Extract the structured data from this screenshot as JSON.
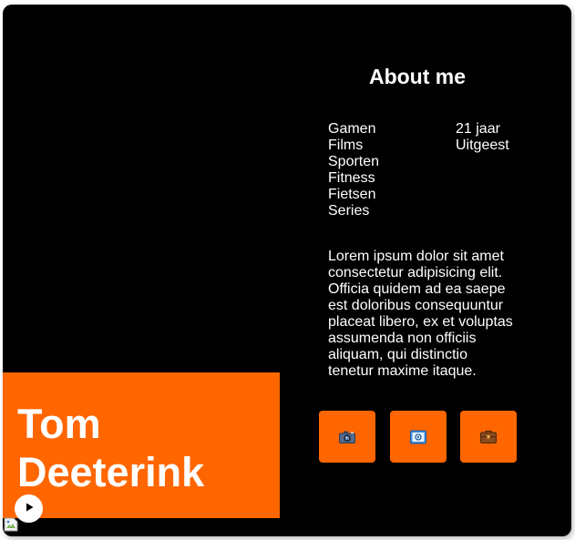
{
  "about": {
    "title": "About me",
    "hobbies": [
      "Gamen",
      "Films",
      "Sporten",
      "Fitness",
      "Fietsen",
      "Series"
    ],
    "info": [
      "21 jaar",
      "Uitgeest"
    ],
    "bio": "Lorem ipsum dolor sit amet consectetur adipisicing elit. Officia quidem ad ea saepe est doloribus consequuntur placeat libero, ex et voluptas assumenda non officiis aliquam, qui distinctio tenetur maxime itaque."
  },
  "buttons": [
    {
      "icon": "camera-icon"
    },
    {
      "icon": "envelope-icon"
    },
    {
      "icon": "briefcase-icon"
    }
  ],
  "profile": {
    "first_name": "Tom",
    "last_name": "Deeterink"
  },
  "colors": {
    "accent": "#ff6600",
    "background": "#000000",
    "text": "#ffffff"
  }
}
